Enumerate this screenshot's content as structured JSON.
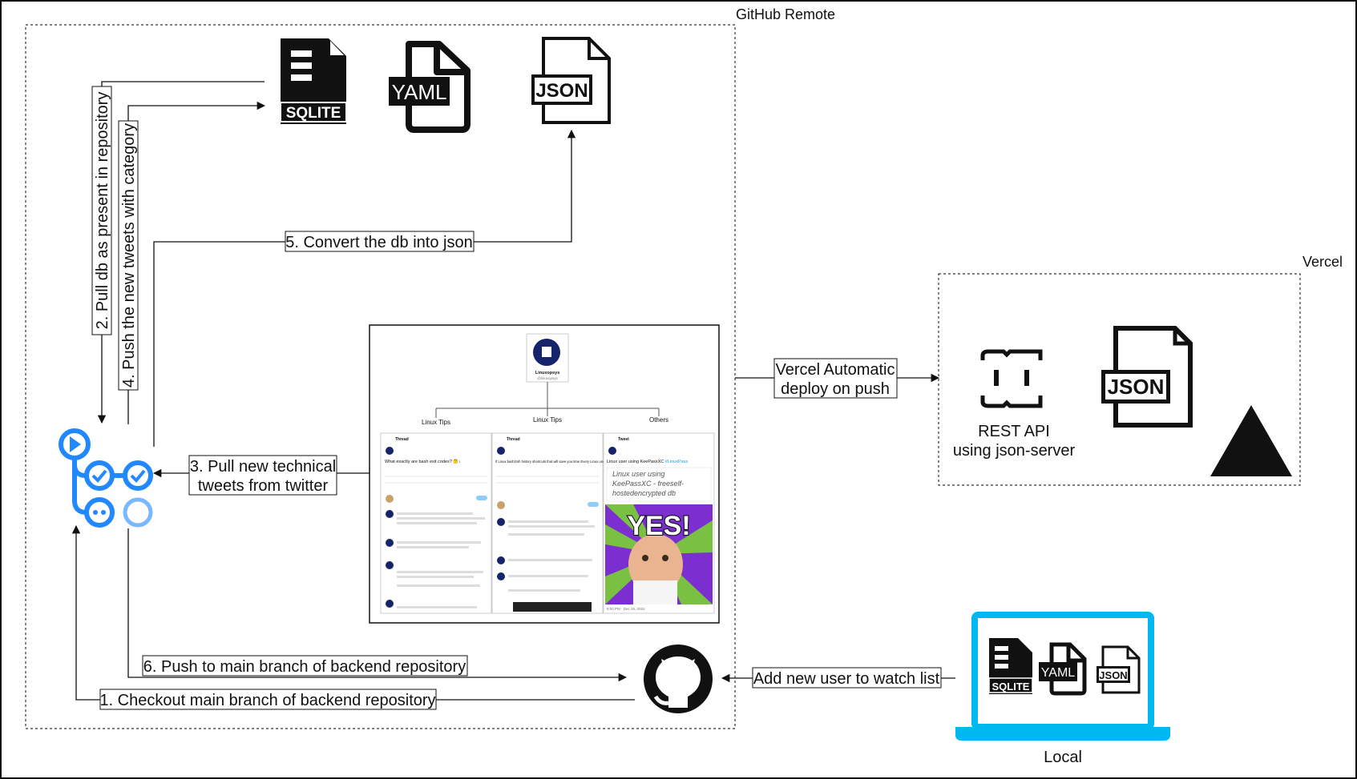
{
  "regions": {
    "github_remote": "GitHub Remote",
    "vercel": "Vercel",
    "local": "Local"
  },
  "files": {
    "sqlite": "SQLITE",
    "yaml": "YAML",
    "json": "JSON"
  },
  "edges": {
    "step1": "1. Checkout main branch of backend repository",
    "step2": "2. Pull db as present in repository",
    "step3_line1": "3. Pull new technical",
    "step3_line2": "tweets from twitter",
    "step4": "4. Push the new tweets with category",
    "step5": "5. Convert the db into json",
    "step6": "6. Push to main branch of backend repository",
    "vercel_line1": "Vercel Automatic",
    "vercel_line2": "deploy on push",
    "add_user": "Add new user to watch list"
  },
  "vercel_box": {
    "rest_line1": "REST API",
    "rest_line2": "using json-server"
  },
  "tweet_tree": {
    "account": "Linuxopsys",
    "handle": "@linuxopsys",
    "categories": [
      "Linux Tips",
      "Linux Tips",
      "Others"
    ],
    "panel1": {
      "header": "Thread",
      "text": "What exactly are bash exit codes? 🤔↓"
    },
    "panel2": {
      "header": "Thread",
      "text": "If Linux bash/zsh history shortcuts that will save you time Every Linux user should know this👇"
    },
    "panel3": {
      "header": "Tweet",
      "text": "Linux user using KeePassXC",
      "hashtag": "#LinuxPass",
      "handwriting_line1": "Linux user using",
      "handwriting_line2": "KeePassXC - freeself-",
      "handwriting_line3": "hostedencrypted db",
      "meme_text": "YES!",
      "footer": "8:00 PM · Dec 26, 2022"
    }
  },
  "icons": {
    "actions": "github-actions-icon",
    "github": "github-icon",
    "laptop": "laptop-icon",
    "json_server": "json-server-icon",
    "vercel_logo": "vercel-triangle-icon"
  },
  "colors": {
    "actions_blue": "#2188ff",
    "actions_light_blue": "#79b8ff",
    "laptop_cyan": "#00b8f0",
    "meme_purple": "#7b2fd0",
    "meme_green": "#7ac143"
  }
}
